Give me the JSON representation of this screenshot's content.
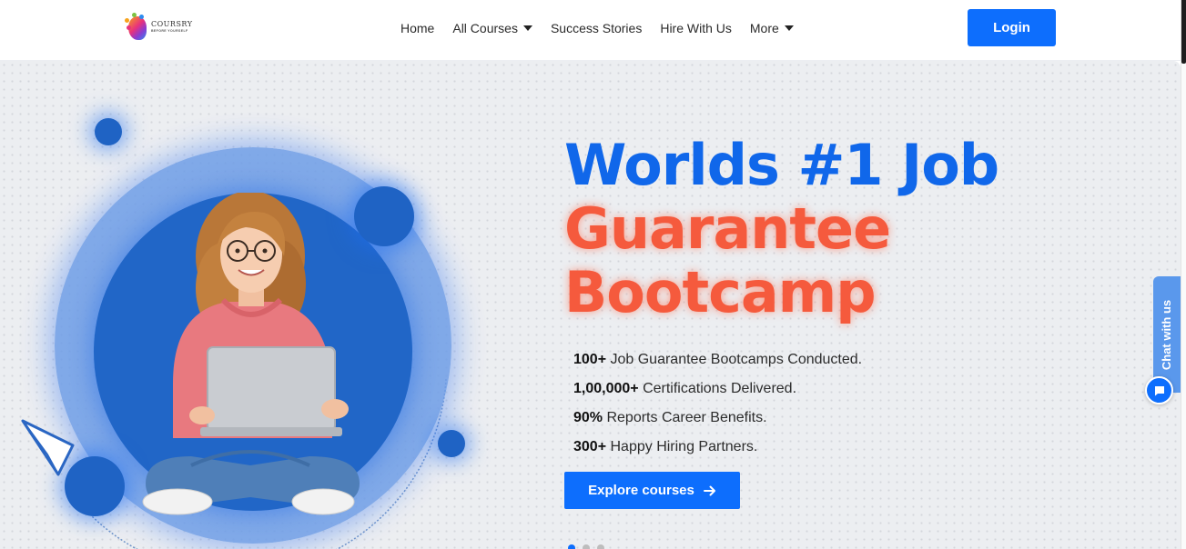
{
  "header": {
    "logo": {
      "brand": "COURSRY",
      "tagline": "BEFORE YOURSELF"
    },
    "nav": [
      {
        "label": "Home",
        "dropdown": false
      },
      {
        "label": "All Courses",
        "dropdown": true
      },
      {
        "label": "Success Stories",
        "dropdown": false
      },
      {
        "label": "Hire With Us",
        "dropdown": false
      },
      {
        "label": "More",
        "dropdown": true
      }
    ],
    "login_label": "Login"
  },
  "hero": {
    "title_line1": "Worlds #1 Job",
    "title_line2": "Guarantee",
    "title_line3": "Bootcamp",
    "stats": [
      {
        "value": "100+",
        "text": " Job Guarantee Bootcamps Conducted."
      },
      {
        "value": "1,00,000+",
        "text": " Certifications Delivered."
      },
      {
        "value": "90%",
        "text": " Reports Career Benefits."
      },
      {
        "value": "300+",
        "text": " Happy Hiring Partners."
      }
    ],
    "cta_label": "Explore courses",
    "carousel": {
      "count": 3,
      "active": 0
    }
  },
  "chat": {
    "label": "Chat with us"
  },
  "colors": {
    "primary": "#0d6efd",
    "title_blue": "#1067ea",
    "title_orange": "#f55a3d",
    "orb": "#2166c7"
  },
  "icons": {
    "dropdown": "caret-down-icon",
    "cta": "arrow-right-icon",
    "chat": "chat-bubble-icon",
    "decor": "paper-plane-icon"
  }
}
